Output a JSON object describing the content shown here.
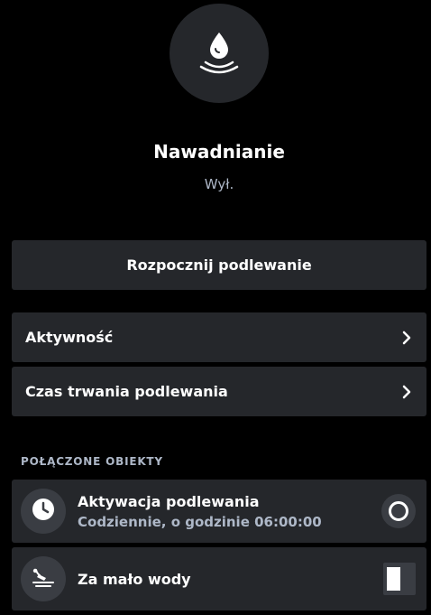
{
  "header": {
    "icon": "water-drop-icon",
    "title": "Nawadnianie",
    "status": "Wył."
  },
  "actions": {
    "start_label": "Rozpocznij podlewanie"
  },
  "menu": [
    {
      "label": "Aktywność",
      "icon": "chevron-right-icon"
    },
    {
      "label": "Czas trwania podlewania",
      "icon": "chevron-right-icon"
    }
  ],
  "linked_objects": {
    "header": "POŁĄCZONE OBIEKTY",
    "items": [
      {
        "title": "Aktywacja podlewania",
        "subtitle": "Codziennie, o godzinie 06:00:00",
        "icon": "clock-icon",
        "control": "radio"
      },
      {
        "title": "Za mało wody",
        "icon": "low-water-icon",
        "control": "state"
      }
    ]
  },
  "colors": {
    "background": "#000000",
    "card": "#25272b",
    "muted_text": "#aeb8c8"
  }
}
